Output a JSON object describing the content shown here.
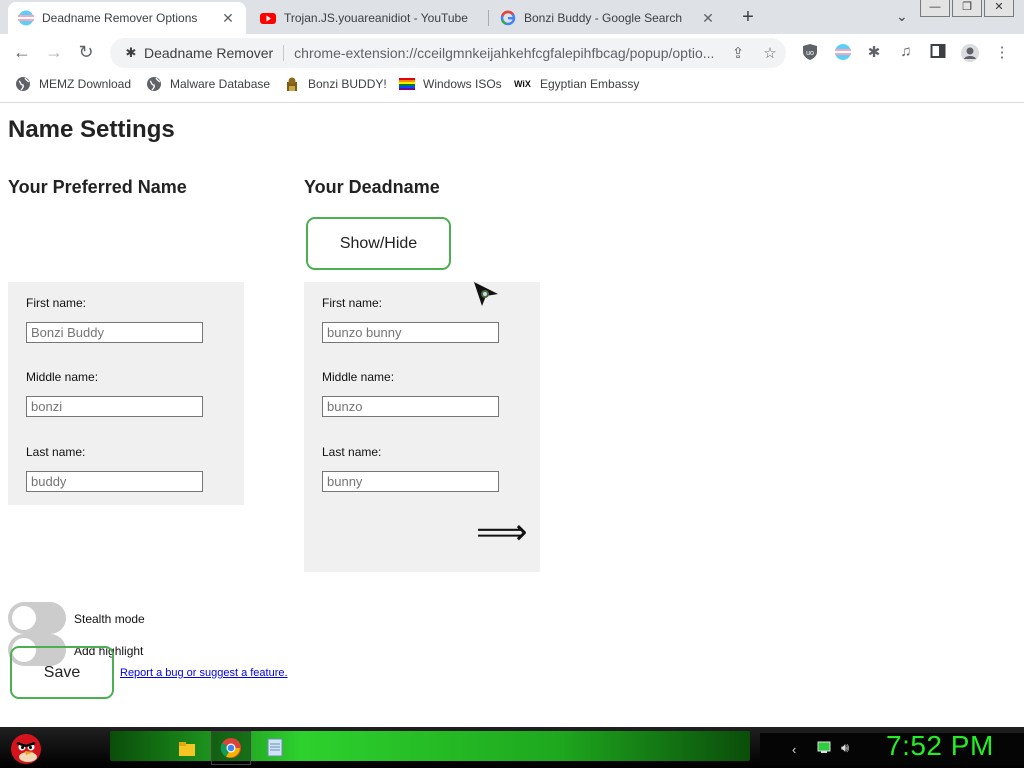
{
  "browser": {
    "tabs": [
      {
        "title": "Deadname Remover Options",
        "active": true
      },
      {
        "title": "Trojan.JS.youareanidiot - YouTube",
        "active": false
      },
      {
        "title": "Bonzi Buddy - Google Search",
        "active": false
      }
    ],
    "window_buttons": {
      "minimize": "—",
      "restore": "❐",
      "close": "✕"
    },
    "toolbar": {
      "site_name": "Deadname Remover",
      "url": "chrome-extension://cceilgmnkeijahkehfcgfalepihfbcag/popup/optio..."
    },
    "bookmarks": [
      {
        "label": "MEMZ Download",
        "icon": "globe-icon"
      },
      {
        "label": "Malware Database",
        "icon": "globe-icon"
      },
      {
        "label": "Bonzi BUDDY!",
        "icon": "bonzi-icon"
      },
      {
        "label": "Windows ISOs",
        "icon": "rainbow-flag-icon"
      },
      {
        "label": "Egyptian Embassy",
        "icon": "wix-icon"
      }
    ]
  },
  "page": {
    "title": "Name Settings",
    "preferred": {
      "heading": "Your Preferred Name",
      "fields": [
        {
          "label": "First name:",
          "placeholder": "Bonzi Buddy"
        },
        {
          "label": "Middle name:",
          "placeholder": "bonzi"
        },
        {
          "label": "Last name:",
          "placeholder": "buddy"
        }
      ]
    },
    "deadname": {
      "heading": "Your Deadname",
      "show_hide_label": "Show/Hide",
      "fields": [
        {
          "label": "First name:",
          "placeholder": "bunzo bunny"
        },
        {
          "label": "Middle name:",
          "placeholder": "bunzo"
        },
        {
          "label": "Last name:",
          "placeholder": "bunny"
        }
      ],
      "arrow": "⟹"
    },
    "toggles": [
      {
        "label": "Stealth mode",
        "on": false
      },
      {
        "label": "Add highlight",
        "on": false
      }
    ],
    "save_label": "Save",
    "report_link": "Report a bug or suggest a feature."
  },
  "taskbar": {
    "clock": "7:52 PM"
  },
  "colors": {
    "accent_green": "#4caf50",
    "clock_green": "#22ee22",
    "panel_bg": "#f0f0f0"
  }
}
